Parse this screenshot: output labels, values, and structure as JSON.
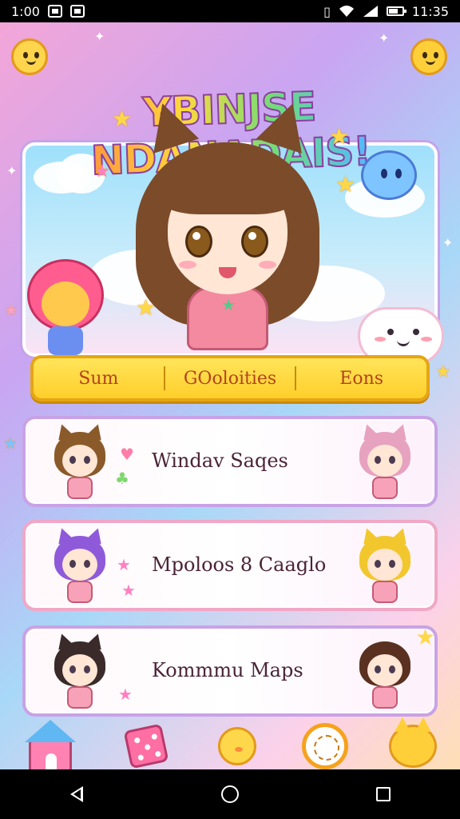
{
  "status_bar": {
    "time_left": "1:00",
    "time_right": "11:35"
  },
  "app": {
    "title": "YBINJSE NDANADAIS!"
  },
  "segmented": {
    "items": [
      "Sum",
      "GOoloities",
      "Eons"
    ]
  },
  "list": {
    "items": [
      {
        "label": "Windav Saqes"
      },
      {
        "label": "Mpoloos 8 Caaglo"
      },
      {
        "label": "Kommmu Maps"
      }
    ]
  },
  "colors": {
    "accent_yellow": "#ffd84a",
    "accent_pink": "#ff82b3",
    "card_border": "#c9a2e6"
  },
  "icons": {
    "bottom": [
      "home-icon",
      "dice-icon",
      "chick-icon",
      "clock-icon",
      "cat-icon"
    ],
    "system": [
      "back-icon",
      "home-circle-icon",
      "recents-icon"
    ]
  }
}
